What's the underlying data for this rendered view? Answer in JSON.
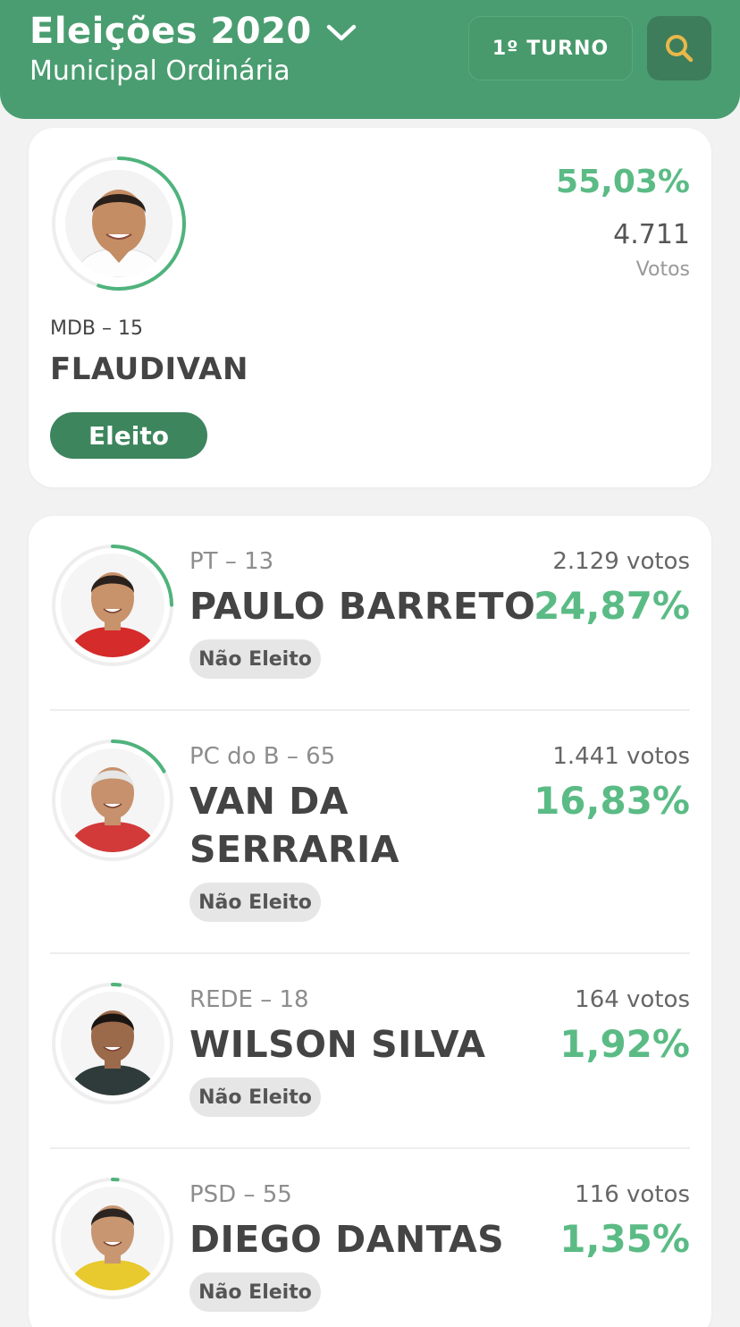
{
  "header": {
    "title": "Eleições 2020",
    "subtitle": "Municipal Ordinária",
    "turno_label": "1º TURNO",
    "search_icon": "search-icon",
    "bg_color": "#4a9d70",
    "accent_color": "#e8b84a"
  },
  "winner": {
    "party": "MDB – 15",
    "name": "FLAUDIVAN",
    "status": "Eleito",
    "percent": "55,03%",
    "votes": "4.711",
    "votes_label": "Votos",
    "ring_fraction": 0.5503
  },
  "candidates": [
    {
      "party": "PT – 13",
      "name_lines": [
        "PAULO BARRETO"
      ],
      "status": "Não Eleito",
      "votes": "2.129 votos",
      "percent": "24,87%",
      "ring_fraction": 0.2487,
      "shirt": "#d52b2b",
      "skin": "#c8926a",
      "hair": "#2a211c"
    },
    {
      "party": "PC do B – 65",
      "name_lines": [
        "VAN DA",
        "SERRARIA"
      ],
      "status": "Não Eleito",
      "votes": "1.441 votos",
      "percent": "16,83%",
      "ring_fraction": 0.1683,
      "shirt": "#d23a3a",
      "skin": "#c6916c",
      "hair": "#e6e6e6"
    },
    {
      "party": "REDE – 18",
      "name_lines": [
        "WILSON SILVA"
      ],
      "status": "Não Eleito",
      "votes": "164 votos",
      "percent": "1,92%",
      "ring_fraction": 0.0192,
      "shirt": "#2f3b3a",
      "skin": "#9b6a4b",
      "hair": "#1b1512"
    },
    {
      "party": "PSD – 55",
      "name_lines": [
        "DIEGO DANTAS"
      ],
      "status": "Não Eleito",
      "votes": "116 votos",
      "percent": "1,35%",
      "ring_fraction": 0.0135,
      "shirt": "#e8c92e",
      "skin": "#c89772",
      "hair": "#2b2420"
    }
  ]
}
